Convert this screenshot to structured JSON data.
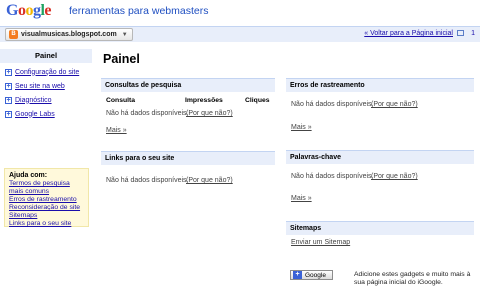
{
  "header": {
    "logo_text": "Google",
    "product_name": "ferramentas para webmasters"
  },
  "sitebar": {
    "site_name": "visualmusicas.blogspot.com",
    "back_link": "« Voltar para a Página inicial",
    "separator": "|",
    "mail_count": "1"
  },
  "sidebar": {
    "heading": "Painel",
    "items": [
      {
        "label": "Configuração do site"
      },
      {
        "label": "Seu site na web"
      },
      {
        "label": "Diagnóstico"
      },
      {
        "label": "Google Labs"
      }
    ],
    "help": {
      "title": "Ajuda com:",
      "links": [
        "Termos de pesquisa mais comuns",
        "Erros de rastreamento",
        "Reconsideração de site",
        "Sitemaps",
        "Links para o seu site"
      ]
    }
  },
  "main": {
    "title": "Painel",
    "no_data": "Não há dados disponíveis.",
    "why_link": "(Por que não?)",
    "more_link": "Mais »",
    "queries": {
      "heading": "Consultas de pesquisa",
      "columns": [
        "Consulta",
        "Impressões",
        "Cliques"
      ]
    },
    "links": {
      "heading": "Links para o seu site"
    },
    "crawl_errors": {
      "heading": "Erros de rastreamento"
    },
    "keywords": {
      "heading": "Palavras-chave"
    },
    "sitemaps": {
      "heading": "Sitemaps",
      "submit_link": "Enviar um Sitemap"
    },
    "igoogle": {
      "button_label": "Google",
      "note": "Adicione estes gadgets e muito mais à sua página inicial do iGoogle."
    }
  }
}
